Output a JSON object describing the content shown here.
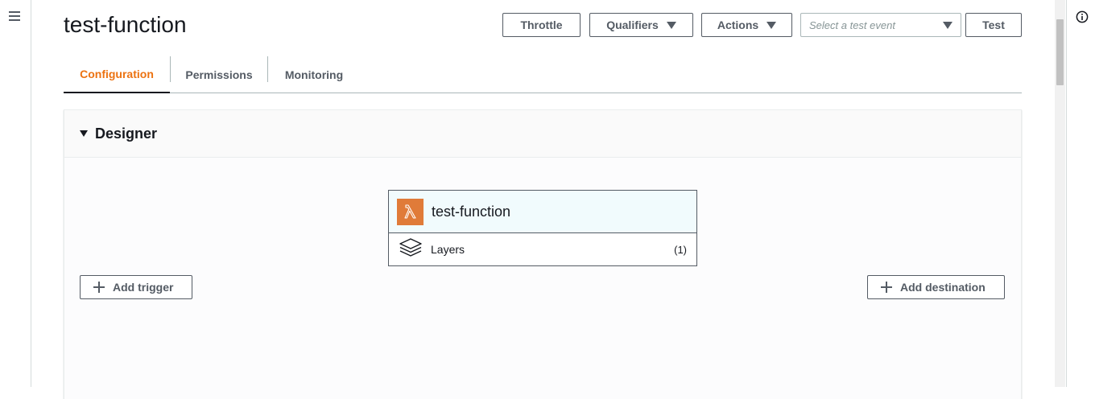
{
  "nav": {
    "menu_icon": "hamburger-menu-icon",
    "info_icon": "info-icon"
  },
  "page": {
    "title": "test-function"
  },
  "header_actions": {
    "throttle_label": "Throttle",
    "qualifiers_label": "Qualifiers",
    "actions_label": "Actions",
    "test_event_placeholder": "Select a test event",
    "test_label": "Test"
  },
  "tabs": [
    {
      "label": "Configuration",
      "active": true
    },
    {
      "label": "Permissions",
      "active": false
    },
    {
      "label": "Monitoring",
      "active": false
    }
  ],
  "designer": {
    "title": "Designer",
    "function_name": "test-function",
    "function_icon": "lambda-icon",
    "layers_label": "Layers",
    "layers_icon": "layers-icon",
    "layers_count": "(1)",
    "add_trigger_label": "Add trigger",
    "add_destination_label": "Add destination"
  },
  "colors": {
    "accent_tab": "#ec7211",
    "lambda_orange": "#e07b39",
    "button_text": "#545b64"
  }
}
